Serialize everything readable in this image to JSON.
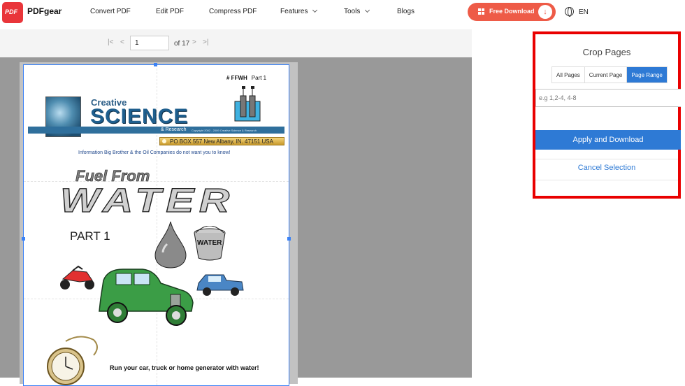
{
  "header": {
    "logo_text": "PDF",
    "brand": "PDFgear",
    "nav": [
      "Convert PDF",
      "Edit PDF",
      "Compress PDF",
      "Features",
      "Tools",
      "Blogs"
    ],
    "download_label": "Free Download",
    "language": "EN",
    "accent": "#ee5b47"
  },
  "viewer": {
    "current_page": "1",
    "of_pages": "of 17",
    "icons": [
      "first-page-icon",
      "prev-page-icon",
      "next-page-icon",
      "last-page-icon"
    ]
  },
  "pdf": {
    "doc_id": "# FFWH",
    "part_label_top": "Part 1",
    "logo_creative": "Creative",
    "logo_science": "SCIENCE",
    "logo_research": "& Research",
    "copyright": "Copyright 2002 - 2009 Creative Science & Research",
    "address": "PO BOX 557  New Albany, IN. 47151   USA",
    "info_line": "Information Big Brother & the Oil Companies do not want you to know!",
    "title_fuel": "Fuel From",
    "title_water": "WATER",
    "part": "PART 1",
    "bucket_label": "WATER",
    "tagline": "Run your car, truck or home generator with water!"
  },
  "crop": {
    "title": "Crop Pages",
    "tabs": [
      "All Pages",
      "Current Page",
      "Page Range"
    ],
    "active_tab": "Page Range",
    "range_placeholder": "e.g 1,2-4, 4-8",
    "apply_label": "Apply and Download",
    "cancel_label": "Cancel Selection",
    "highlight_color": "#e90000",
    "button_color": "#2e7ad5"
  }
}
